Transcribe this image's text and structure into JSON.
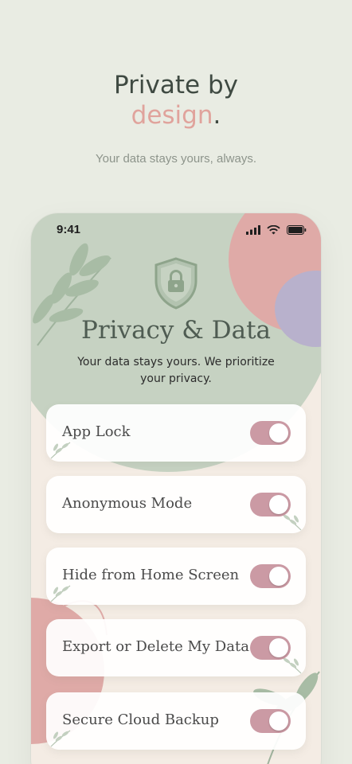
{
  "hero": {
    "title_line1": "Private by",
    "title_accent": "design",
    "title_end": ".",
    "subtitle": "Your data stays yours, always."
  },
  "status_bar": {
    "time": "9:41",
    "icons": [
      "cellular-signal-icon",
      "wifi-icon",
      "battery-icon"
    ]
  },
  "screen": {
    "icon": "shield-lock-icon",
    "title": "Privacy & Data",
    "description": "Your data stays yours. We prioritize your privacy."
  },
  "settings": [
    {
      "label": "App Lock",
      "enabled": true
    },
    {
      "label": "Anonymous Mode",
      "enabled": true
    },
    {
      "label": "Hide from Home Screen",
      "enabled": true
    },
    {
      "label": "Export or Delete My Data",
      "enabled": true
    },
    {
      "label": "Secure Cloud Backup",
      "enabled": true
    }
  ],
  "colors": {
    "background": "#e9ece3",
    "sage": "#c6d2c2",
    "rose": "#dfaaa7",
    "lavender": "#b8b1cc",
    "toggle_on": "#cb9aa4",
    "accent_text": "#e0a39c"
  }
}
